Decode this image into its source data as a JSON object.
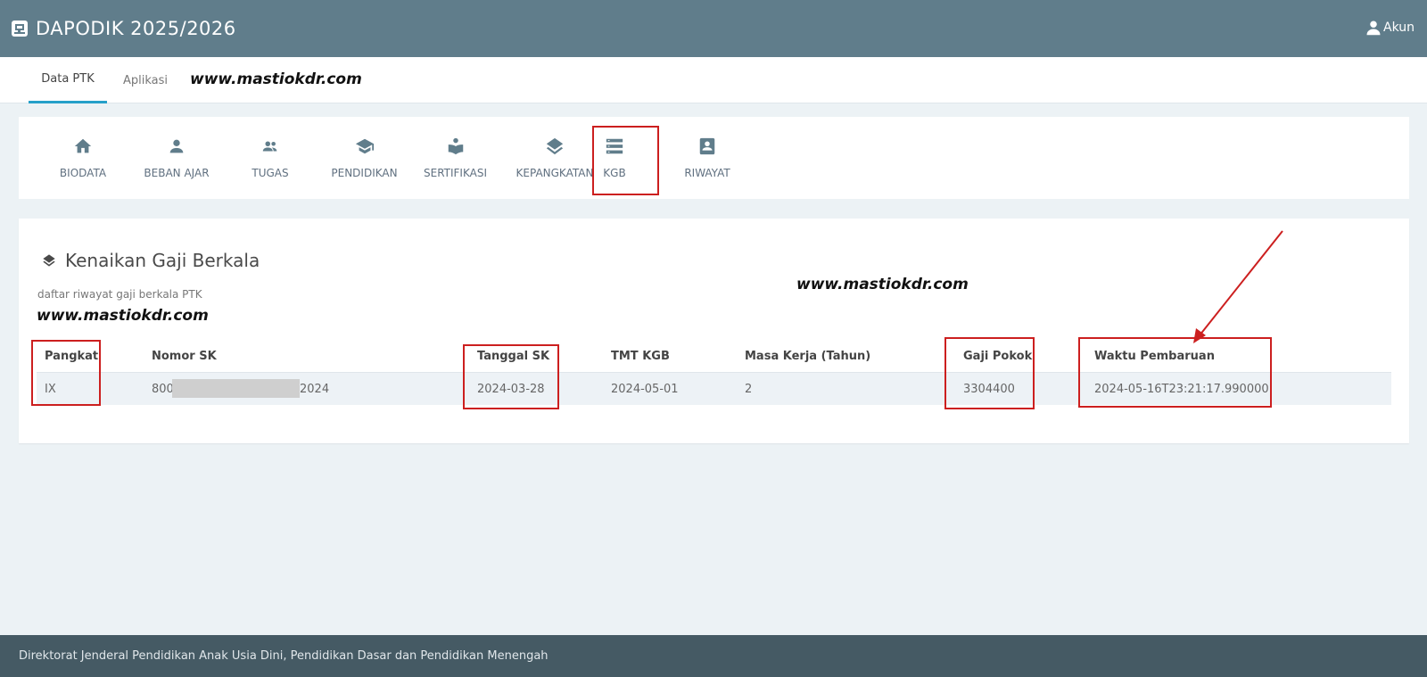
{
  "app": {
    "title": "DAPODIK 2025/2026",
    "account_label": "Akun"
  },
  "tabs": [
    {
      "label": "Data PTK",
      "active": true
    },
    {
      "label": "Aplikasi",
      "active": false
    }
  ],
  "watermarks": [
    "www.mastiokdr.com",
    "www.mastiokdr.com",
    "www.mastiokdr.com"
  ],
  "menu": [
    {
      "label": "BIODATA",
      "icon": "home-icon"
    },
    {
      "label": "BEBAN AJAR",
      "icon": "person-icon"
    },
    {
      "label": "TUGAS",
      "icon": "people-icon"
    },
    {
      "label": "PENDIDIKAN",
      "icon": "graduation-cap-icon"
    },
    {
      "label": "SERTIFIKASI",
      "icon": "reading-person-icon"
    },
    {
      "label": "KEPANGKATAN",
      "icon": "layers-icon"
    },
    {
      "label": "KGB",
      "icon": "storage-list-icon",
      "highlighted": true
    },
    {
      "label": "RIWAYAT",
      "icon": "contact-card-icon"
    }
  ],
  "section": {
    "title": "Kenaikan Gaji Berkala",
    "subtitle": "daftar riwayat gaji berkala PTK"
  },
  "table": {
    "headers": [
      "Pangkat",
      "Nomor SK",
      "Tanggal SK",
      "TMT KGB",
      "Masa Kerja (Tahun)",
      "Gaji Pokok",
      "Waktu Pembaruan"
    ],
    "rows": [
      {
        "pangkat": "IX",
        "nomor_sk_prefix": "800",
        "nomor_sk_suffix": "2024",
        "tanggal_sk": "2024-03-28",
        "tmt_kgb": "2024-05-01",
        "masa_kerja": "2",
        "gaji_pokok": "3304400",
        "waktu_pembaruan": "2024-05-16T23:21:17.990000"
      }
    ]
  },
  "footer": {
    "text": "Direktorat Jenderal Pendidikan Anak Usia Dini, Pendidikan Dasar dan Pendidikan Menengah"
  },
  "colors": {
    "appbar": "#607d8b",
    "footer": "#455a64",
    "active_tab": "#26a0c9",
    "annotation_red": "#cc1f1f",
    "icon": "#607d8b"
  }
}
